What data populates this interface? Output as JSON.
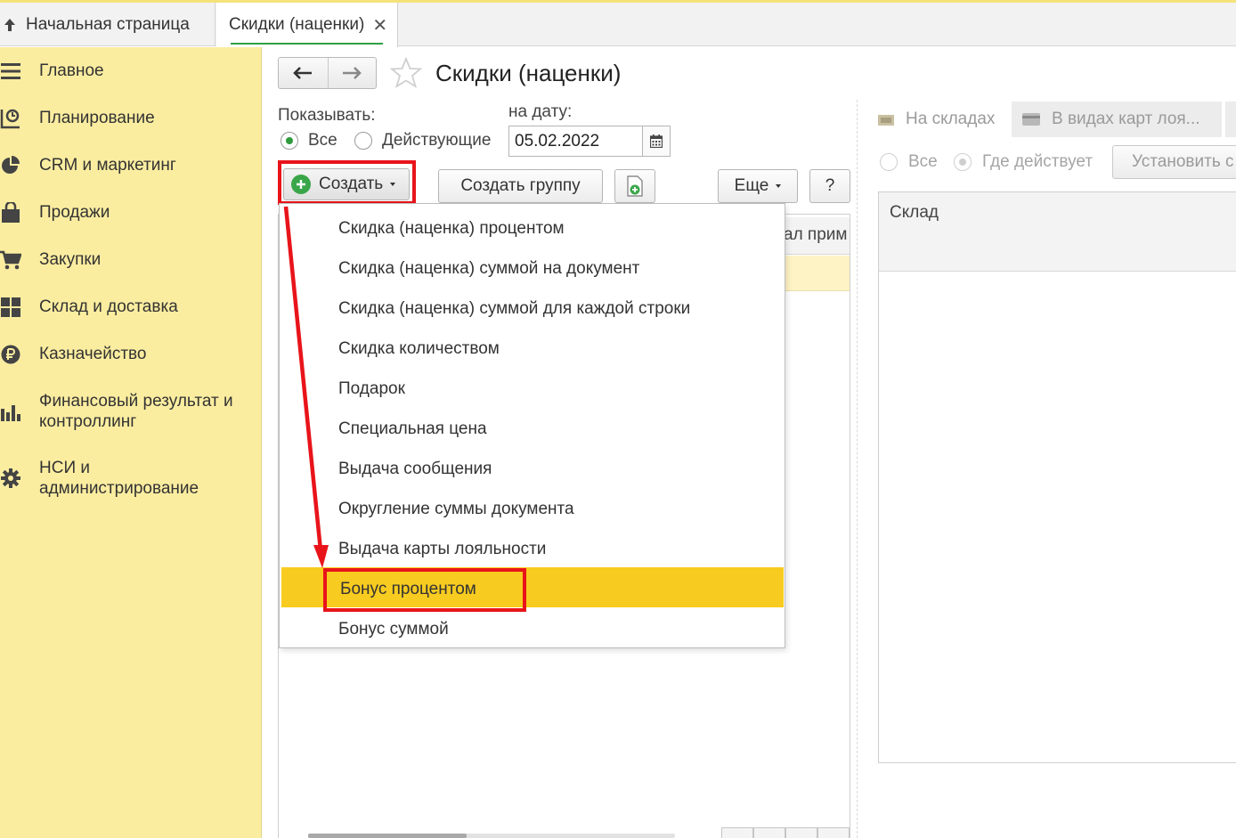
{
  "tabs": {
    "home_label": "Начальная страница",
    "active_label": "Скидки (наценки)",
    "close_glyph": "✕"
  },
  "sidebar": {
    "items": [
      {
        "label": "Главное",
        "icon": "menu-icon"
      },
      {
        "label": "Планирование",
        "icon": "planning-icon"
      },
      {
        "label": "CRM и маркетинг",
        "icon": "pie-chart-icon"
      },
      {
        "label": "Продажи",
        "icon": "shopping-bag-icon"
      },
      {
        "label": "Закупки",
        "icon": "cart-icon"
      },
      {
        "label": "Склад и доставка",
        "icon": "warehouse-grid-icon"
      },
      {
        "label": "Казначейство",
        "icon": "ruble-coin-icon"
      },
      {
        "label": "Финансовый результат и контроллинг",
        "icon": "bar-chart-icon"
      },
      {
        "label": "НСИ и администрирование",
        "icon": "gear-icon"
      }
    ]
  },
  "header": {
    "title": "Скидки (наценки)"
  },
  "filters": {
    "show_label": "Показывать:",
    "all_option": "Все",
    "active_option": "Действующие",
    "selected": "Все",
    "date_label": "на дату:",
    "date_value": "05.02.2022"
  },
  "toolbar": {
    "create_label": "Создать",
    "create_group_label": "Создать группу",
    "more_label": "Еще",
    "help_label": "?"
  },
  "list": {
    "column_partial": "ал прим"
  },
  "create_menu": {
    "items": [
      "Скидка (наценка) процентом",
      "Скидка (наценка) суммой на документ",
      "Скидка (наценка) суммой для каждой строки",
      "Скидка количеством",
      "Подарок",
      "Специальная цена",
      "Выдача сообщения",
      "Округление суммы документа",
      "Выдача карты лояльности",
      "Бонус процентом",
      "Бонус суммой"
    ],
    "highlighted": "Бонус процентом"
  },
  "right_panel": {
    "tab_warehouses": "На складах",
    "tab_loyalty": "В видах карт лоя...",
    "all_option": "Все",
    "where_active_option": "Где действует",
    "set_button": "Установить с",
    "column_warehouse": "Склад"
  },
  "colors": {
    "sidebar_bg": "#fbeda0",
    "highlight": "#f8cb20",
    "annotation_red": "#e8141a",
    "accent_green": "#3aa64a"
  }
}
